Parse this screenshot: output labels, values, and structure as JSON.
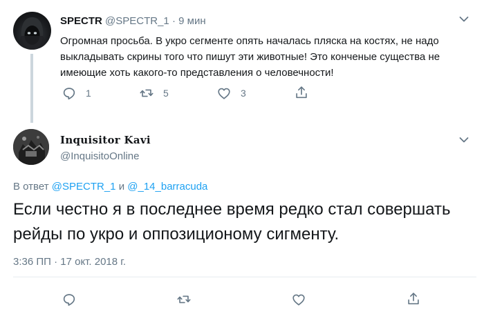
{
  "tweet1": {
    "display_name": "SPECTR",
    "handle": "@SPECTR_1",
    "separator": "·",
    "time": "9 мин",
    "text": "Огромная просьба. В укро сегменте опять началась пляска на костях, не надо выкладывать скрины того что пишут эти животные! Это конченые существа не имеющие хоть какого-то представления о человечности!",
    "actions": {
      "reply_count": "1",
      "retweet_count": "5",
      "like_count": "3"
    }
  },
  "tweet2": {
    "display_name": "Inquisitor Kavi",
    "handle": "@InquisitoOnline",
    "reply_prefix": "В ответ",
    "reply_to_1": "@SPECTR_1",
    "reply_and": "и",
    "reply_to_2": "@_14_barracuda",
    "text": "Если честно я в последнее время редко стал совершать рейды по укро и оппозиционому сигменту.",
    "timestamp": "3:36 ПП · 17 окт. 2018 г."
  },
  "icons": {
    "reply": "reply-icon",
    "retweet": "retweet-icon",
    "like": "like-icon",
    "share": "share-icon",
    "more": "chevron-down-icon"
  },
  "colors": {
    "text": "#14171a",
    "muted": "#657786",
    "link": "#1da1f2",
    "thread_line": "#ccd6dd"
  }
}
